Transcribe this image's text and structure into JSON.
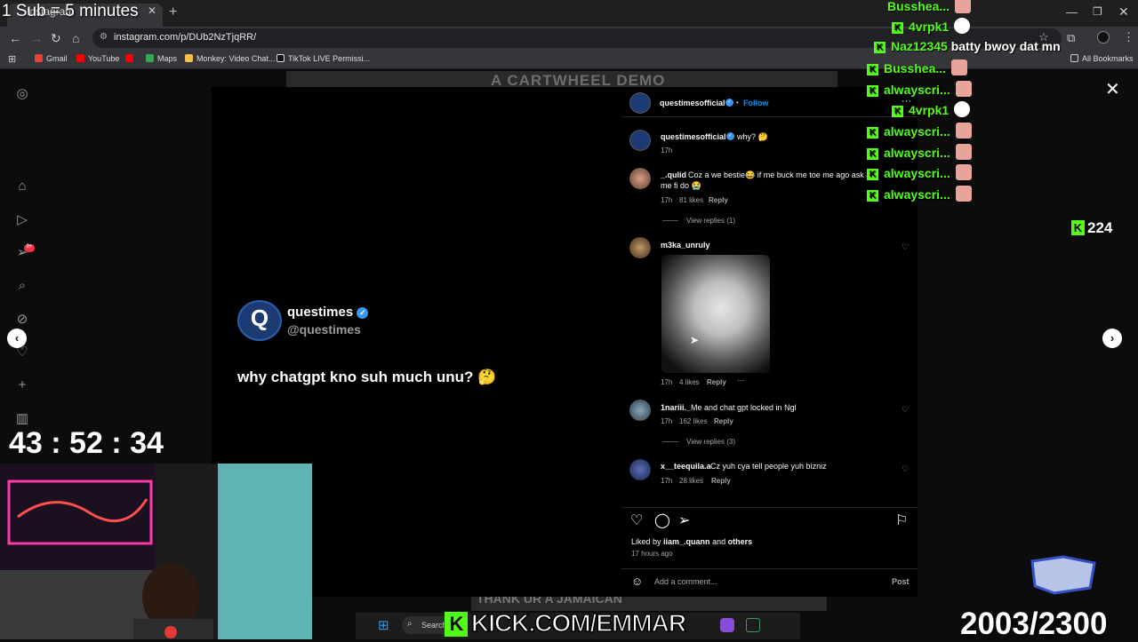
{
  "browser": {
    "tab_title": "Instagram",
    "new_tab": "+",
    "url": "instagram.com/p/DUb2NzTjqRR/",
    "bookmarks": [
      "Gmail",
      "YouTube",
      "Maps",
      "Monkey: Video Chat...",
      "TikTok LIVE Permissi..."
    ],
    "all_bookmarks": "All Bookmarks"
  },
  "background_post": {
    "top_text": "A CARTWHEEL DEMO",
    "bottom_text": "THANK UR A JAMAICAN"
  },
  "post": {
    "tweet_name": "questimes",
    "tweet_handle": "@questimes",
    "tweet_text": "why chatgpt kno suh much unu? 🤔",
    "logo_glyph": "Q"
  },
  "panel": {
    "author": "questimesofficial",
    "follow": "Follow",
    "caption_user": "questimesofficial",
    "caption_text": "why? 🤔",
    "caption_time": "17h",
    "comments": [
      {
        "user": "_.qulid",
        "text": "Coz a we bestie😂 if me buck me toe me ago ask ah",
        "text2": "me fi do 😭",
        "time": "17h",
        "likes": "81 likes",
        "reply": "Reply",
        "view_replies": "View replies (1)"
      },
      {
        "user": "m3ka_unruly",
        "time": "17h",
        "likes": "4 likes",
        "reply": "Reply",
        "more": "···"
      },
      {
        "user": "1nariii._",
        "text": "Me and chat gpt locked in Ngl",
        "time": "17h",
        "likes": "162 likes",
        "reply": "Reply",
        "view_replies": "View replies (3)"
      },
      {
        "user": "x__teequila.a",
        "text": "Cz yuh cya tell people yuh bizniz",
        "time": "17h",
        "likes": "28 likes",
        "reply": "Reply"
      }
    ],
    "liked_by_prefix": "Liked by",
    "liked_by_user": "iiam_.quann",
    "liked_by_and": "and",
    "liked_by_others": "others",
    "posted_ago": "17 hours ago",
    "add_comment_placeholder": "Add a comment...",
    "post_button": "Post"
  },
  "stream": {
    "overlay_title": "1 Sub = 5 minutes",
    "timer": "43 : 52 : 34",
    "viewers": "224",
    "kick_url": "KICK.COM/EMMAR",
    "sub_count": "2003/2300",
    "chat": [
      {
        "user": "Busshea...",
        "msg": ""
      },
      {
        "user": "4vrpk1",
        "msg": ""
      },
      {
        "user": "Naz12345",
        "msg": "batty bwoy dat mn"
      },
      {
        "user": "Busshea...",
        "msg": ""
      },
      {
        "user": "alwayscri...",
        "msg": ""
      },
      {
        "user": "4vrpk1",
        "msg": ""
      },
      {
        "user": "alwayscri...",
        "msg": ""
      },
      {
        "user": "alwayscri...",
        "msg": ""
      },
      {
        "user": "alwayscri...",
        "msg": ""
      },
      {
        "user": "alwayscri...",
        "msg": ""
      }
    ]
  },
  "taskbar": {
    "search": "Search"
  },
  "colors": {
    "kick_green": "#53fc18",
    "instagram_blue": "#3897f0"
  }
}
